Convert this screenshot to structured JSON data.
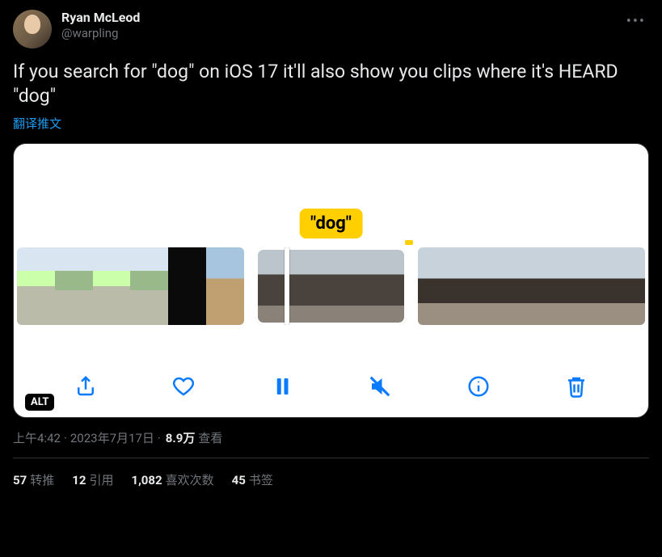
{
  "user": {
    "display_name": "Ryan McLeod",
    "handle": "@warpling"
  },
  "text": "If you search for \"dog\" on iOS 17 it'll also show you clips where it's HEARD \"dog\"",
  "translate_label": "翻译推文",
  "media": {
    "search_term": "\"dog\"",
    "alt_label": "ALT",
    "toolbar": {
      "share": "share",
      "like": "like",
      "pause": "pause",
      "mute": "mute",
      "info": "info",
      "delete": "delete"
    }
  },
  "meta": {
    "time": "上午4:42",
    "dot1": " · ",
    "date": "2023年7月17日",
    "dot2": " · ",
    "views_count": "8.9万",
    "views_label": " 查看"
  },
  "stats": {
    "retweets": {
      "num": "57",
      "label": "转推"
    },
    "quotes": {
      "num": "12",
      "label": "引用"
    },
    "likes": {
      "num": "1,082",
      "label": "喜欢次数"
    },
    "bookmarks": {
      "num": "45",
      "label": "书签"
    }
  }
}
